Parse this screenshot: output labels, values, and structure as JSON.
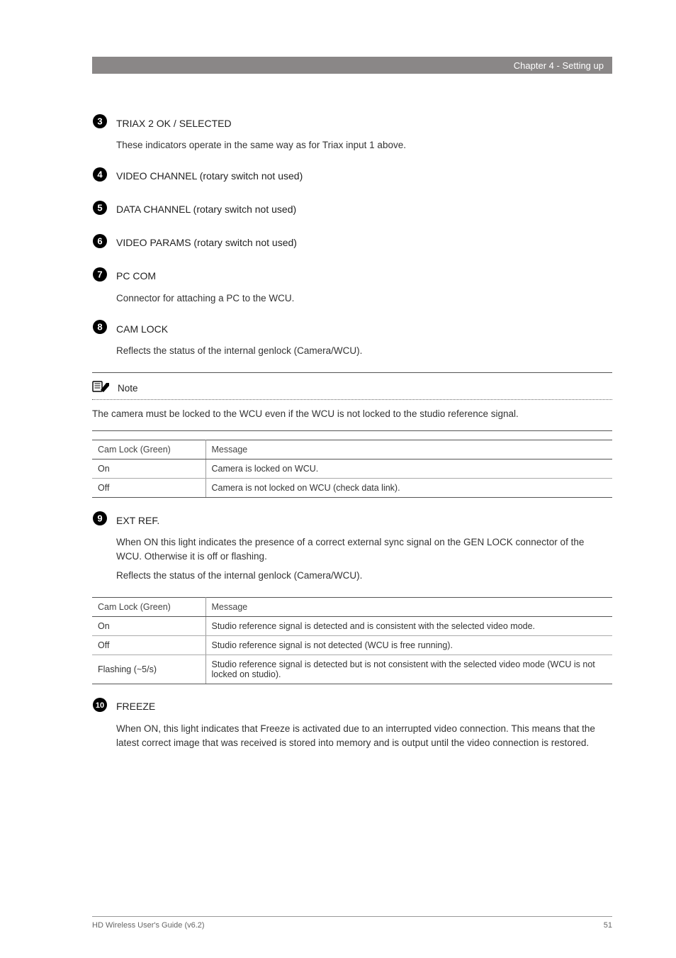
{
  "header": {
    "chapter": "Chapter 4 - Setting up"
  },
  "items": [
    {
      "num": "3",
      "title": "TRIAX 2 OK / SELECTED",
      "body": [
        "These indicators operate in the same way as for Triax input 1 above."
      ]
    },
    {
      "num": "4",
      "title": "VIDEO CHANNEL (rotary switch not used)",
      "body": []
    },
    {
      "num": "5",
      "title": "DATA CHANNEL (rotary switch not used)",
      "body": []
    },
    {
      "num": "6",
      "title": "VIDEO PARAMS (rotary switch not used)",
      "body": []
    },
    {
      "num": "7",
      "title": "PC COM",
      "body": [
        "Connector for attaching a PC to the WCU."
      ]
    },
    {
      "num": "8",
      "title": "CAM LOCK",
      "body": [
        "Reflects the status of the internal genlock (Camera/WCU)."
      ]
    }
  ],
  "note": {
    "label": "Note",
    "text": "The camera must be locked to the WCU even if the WCU is not locked to the studio reference signal."
  },
  "table1": {
    "headers": [
      "Cam Lock (Green)",
      "Message"
    ],
    "rows": [
      [
        "On",
        "Camera is locked on WCU."
      ],
      [
        "Off",
        "Camera is not locked on WCU (check data link)."
      ]
    ]
  },
  "item9": {
    "num": "9",
    "title": "EXT REF.",
    "body": [
      "When ON this light indicates the presence of a correct external sync signal on the GEN LOCK connector of the WCU. Otherwise it is off or flashing.",
      "Reflects the status of the internal genlock (Camera/WCU)."
    ]
  },
  "table2": {
    "headers": [
      "Cam Lock (Green)",
      "Message"
    ],
    "rows": [
      [
        "On",
        "Studio reference signal is detected and is consistent with the selected video mode."
      ],
      [
        "Off",
        "Studio reference signal is not detected (WCU is free running)."
      ],
      [
        "Flashing (~5/s)",
        "Studio reference signal is detected but is not consistent with the selected video mode (WCU is not locked on studio)."
      ]
    ]
  },
  "item10": {
    "num": "10",
    "title": "FREEZE",
    "body": [
      "When ON, this light indicates that Freeze is activated due to an interrupted video connection. This means that the latest correct image that was received is stored into memory and is output until the video connection is restored."
    ]
  },
  "footer": {
    "left": "HD Wireless User's Guide (v6.2)",
    "right": "51"
  }
}
